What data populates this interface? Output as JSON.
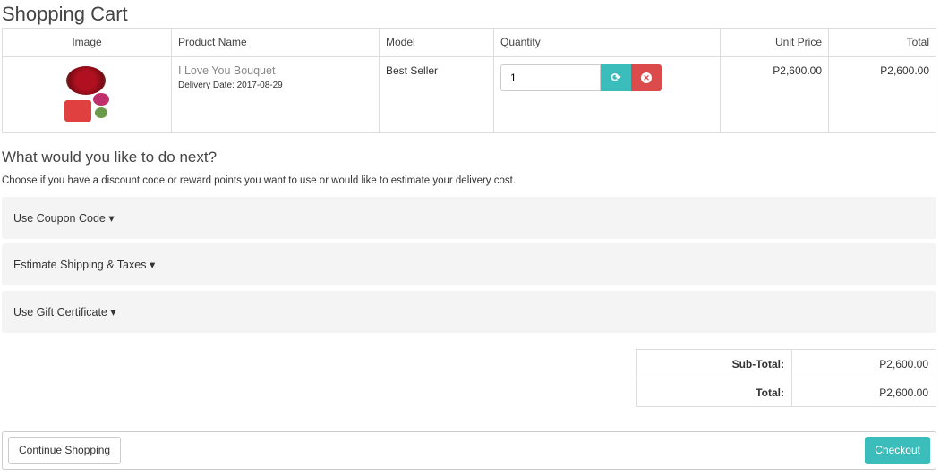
{
  "title": "Shopping Cart",
  "table": {
    "headers": [
      "Image",
      "Product Name",
      "Model",
      "Quantity",
      "Unit Price",
      "Total"
    ],
    "row": {
      "name": "I Love You Bouquet",
      "delivery": "Delivery Date: 2017-08-29",
      "model": "Best Seller",
      "quantity": "1",
      "unit_price": "P2,600.00",
      "total": "P2,600.00"
    }
  },
  "next": {
    "heading": "What would you like to do next?",
    "hint": "Choose if you have a discount code or reward points you want to use or would like to estimate your delivery cost.",
    "panels": [
      "Use Coupon Code",
      "Estimate Shipping & Taxes",
      "Use Gift Certificate"
    ]
  },
  "totals": [
    {
      "label": "Sub-Total:",
      "value": "P2,600.00"
    },
    {
      "label": "Total:",
      "value": "P2,600.00"
    }
  ],
  "buttons": {
    "continue": "Continue Shopping",
    "checkout": "Checkout"
  }
}
